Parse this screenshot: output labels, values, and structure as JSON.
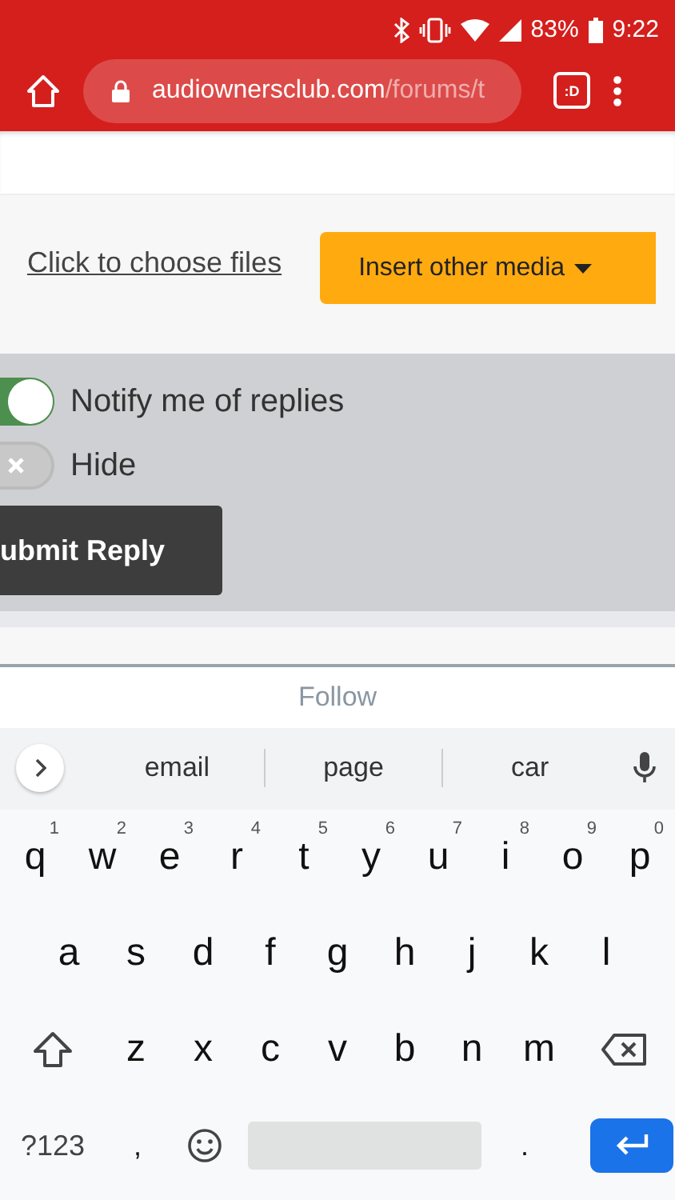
{
  "status_bar": {
    "battery": "83%",
    "time": "9:22"
  },
  "browser": {
    "url_host": "audiownersclub.com",
    "url_path": "/forums/t",
    "tab_label": ":D"
  },
  "attach": {
    "link": "Click to choose files",
    "media_button": "Insert other media"
  },
  "options": [
    {
      "label": "Notify me of replies",
      "on": true
    },
    {
      "label": "Hide",
      "on": false
    }
  ],
  "submit_button": "ubmit Reply",
  "follow": "Follow",
  "suggestions": [
    "email",
    "page",
    "car"
  ],
  "keyboard": {
    "rows": [
      [
        {
          "kind": "letter",
          "label": "q",
          "hint": "1"
        },
        {
          "kind": "letter",
          "label": "w",
          "hint": "2"
        },
        {
          "kind": "letter",
          "label": "e",
          "hint": "3"
        },
        {
          "kind": "letter",
          "label": "r",
          "hint": "4"
        },
        {
          "kind": "letter",
          "label": "t",
          "hint": "5"
        },
        {
          "kind": "letter",
          "label": "y",
          "hint": "6"
        },
        {
          "kind": "letter",
          "label": "u",
          "hint": "7"
        },
        {
          "kind": "letter",
          "label": "i",
          "hint": "8"
        },
        {
          "kind": "letter",
          "label": "o",
          "hint": "9"
        },
        {
          "kind": "letter",
          "label": "p",
          "hint": "0"
        }
      ],
      [
        {
          "kind": "letter",
          "label": "a"
        },
        {
          "kind": "letter",
          "label": "s"
        },
        {
          "kind": "letter",
          "label": "d"
        },
        {
          "kind": "letter",
          "label": "f"
        },
        {
          "kind": "letter",
          "label": "g"
        },
        {
          "kind": "letter",
          "label": "h"
        },
        {
          "kind": "letter",
          "label": "j"
        },
        {
          "kind": "letter",
          "label": "k"
        },
        {
          "kind": "letter",
          "label": "l"
        }
      ],
      [
        {
          "kind": "shift"
        },
        {
          "kind": "letter",
          "label": "z"
        },
        {
          "kind": "letter",
          "label": "x"
        },
        {
          "kind": "letter",
          "label": "c"
        },
        {
          "kind": "letter",
          "label": "v"
        },
        {
          "kind": "letter",
          "label": "b"
        },
        {
          "kind": "letter",
          "label": "n"
        },
        {
          "kind": "letter",
          "label": "m"
        },
        {
          "kind": "backspace"
        }
      ],
      [
        {
          "kind": "symbols",
          "label": "?123"
        },
        {
          "kind": "letter",
          "label": ","
        },
        {
          "kind": "emoji"
        },
        {
          "kind": "space"
        },
        {
          "kind": "letter",
          "label": "."
        },
        {
          "kind": "enter"
        }
      ]
    ]
  }
}
